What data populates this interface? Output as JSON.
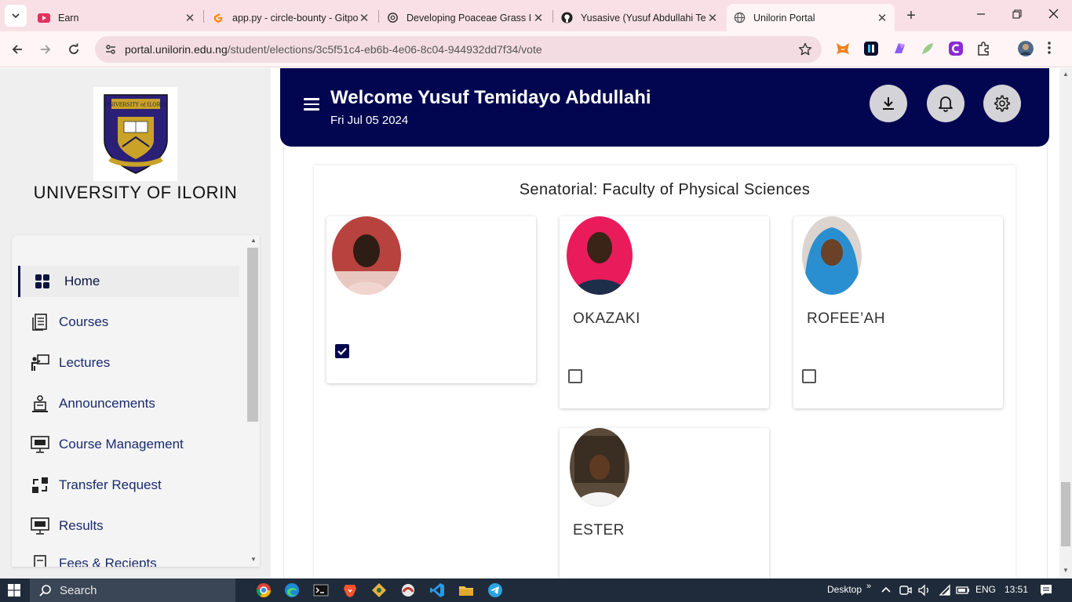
{
  "browser": {
    "tabs": [
      {
        "title": "Earn",
        "icon": "youtube-icon"
      },
      {
        "title": "app.py - circle-bounty - Gitpod",
        "icon": "gitpod-icon"
      },
      {
        "title": "Developing Poaceae Grass ID",
        "icon": "openai-icon"
      },
      {
        "title": "Yusasive (Yusuf Abdullahi Te",
        "icon": "github-icon"
      },
      {
        "title": "Unilorin Portal",
        "icon": "globe-icon"
      }
    ],
    "url_host": "portal.unilorin.edu.ng",
    "url_path": "/student/elections/3c5f51c4-eb6b-4e06-8c04-944932dd7f34/vote"
  },
  "sidebar": {
    "university_name": "UNIVERSITY OF ILORIN",
    "logo_text": "UNIVERSITY of ILORIN",
    "items": [
      {
        "label": "Home",
        "icon": "dashboard-icon"
      },
      {
        "label": "Courses",
        "icon": "book-icon"
      },
      {
        "label": "Lectures",
        "icon": "lecturer-icon"
      },
      {
        "label": "Announcements",
        "icon": "announcement-icon"
      },
      {
        "label": "Course Management",
        "icon": "monitor-icon"
      },
      {
        "label": "Transfer Request",
        "icon": "transfer-icon"
      },
      {
        "label": "Results",
        "icon": "monitor-icon"
      },
      {
        "label": "Fees & Reciepts",
        "icon": "receipt-icon"
      }
    ]
  },
  "header": {
    "welcome": "Welcome Yusuf Temidayo Abdullahi",
    "date": "Fri Jul 05 2024"
  },
  "ballot": {
    "title": "Senatorial: Faculty of Physical Sciences",
    "candidates": [
      {
        "name": "",
        "checked": true
      },
      {
        "name": "OKAZAKI",
        "checked": false
      },
      {
        "name": "ROFEE’AH",
        "checked": false
      },
      {
        "name": "ESTER",
        "checked": false
      }
    ]
  },
  "taskbar": {
    "search": "Search",
    "desktop": "Desktop",
    "language": "ENG",
    "time": "13:51"
  },
  "colors": {
    "navy": "#020650",
    "sidebar_bg": "#efefef",
    "menu_text": "#1a2a6c"
  }
}
